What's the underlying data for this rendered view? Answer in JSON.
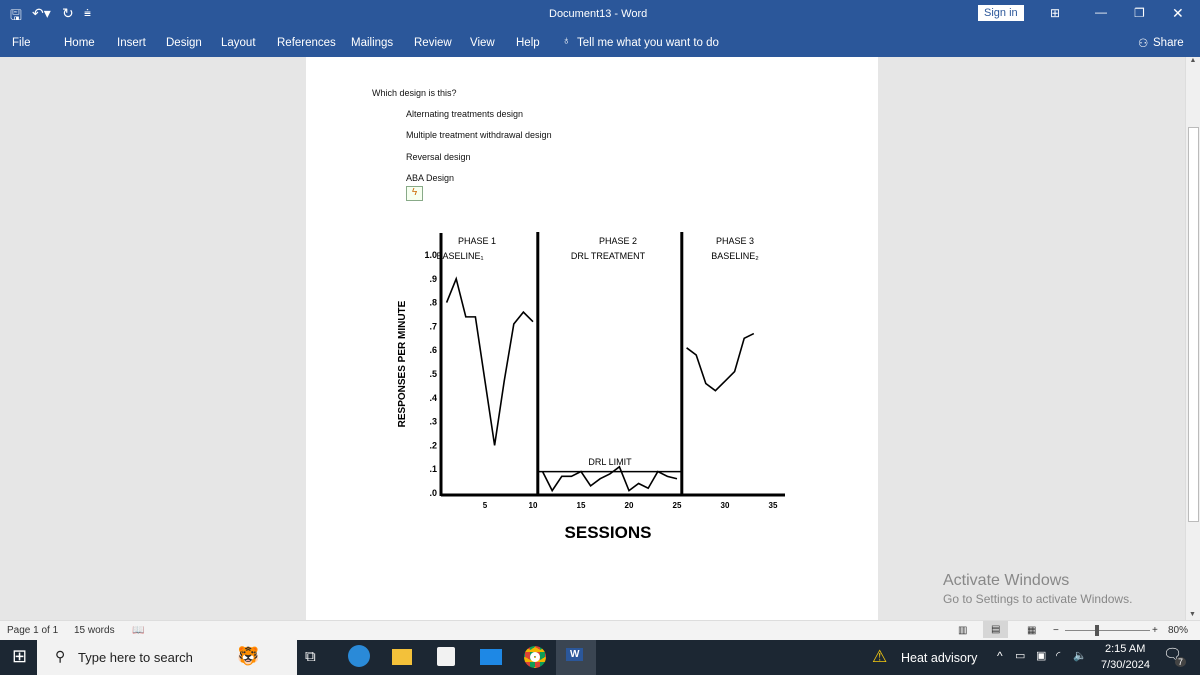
{
  "window": {
    "title": "Document13  -  Word",
    "sign_in": "Sign in"
  },
  "ribbon": {
    "tabs": [
      "File",
      "Home",
      "Insert",
      "Design",
      "Layout",
      "References",
      "Mailings",
      "Review",
      "View",
      "Help"
    ],
    "tell_me": "Tell me what you want to do",
    "share": "Share"
  },
  "document": {
    "question": "Which design is this?",
    "options": [
      "Alternating treatments design",
      "Multiple treatment withdrawal design",
      "Reversal design",
      "ABA Design"
    ]
  },
  "chart_data": {
    "type": "line",
    "xlabel": "SESSIONS",
    "ylabel": "RESPONSES  PER  MINUTE",
    "xlim": [
      0,
      35
    ],
    "ylim": [
      0,
      1.0
    ],
    "x_ticks": [
      "5",
      "10",
      "15",
      "20",
      "25",
      "30",
      "35"
    ],
    "y_ticks": [
      ".0",
      ".1",
      ".2",
      ".3",
      ".4",
      ".5",
      ".6",
      ".7",
      ".8",
      ".9",
      "1.0"
    ],
    "phases": [
      {
        "title": "PHASE  1",
        "subtitle": "BASELINE₁",
        "sessions": [
          1,
          2,
          3,
          4,
          5,
          6,
          7,
          8,
          9,
          10
        ],
        "values": [
          0.8,
          0.9,
          0.74,
          0.74,
          0.47,
          0.2,
          0.47,
          0.71,
          0.76,
          0.72
        ]
      },
      {
        "title": "PHASE  2",
        "subtitle": "DRL   TREATMENT",
        "sessions": [
          11,
          12,
          13,
          14,
          15,
          16,
          17,
          18,
          19,
          20,
          21,
          22,
          23,
          24,
          25
        ],
        "values": [
          0.09,
          0.01,
          0.07,
          0.07,
          0.09,
          0.03,
          0.06,
          0.08,
          0.11,
          0.01,
          0.04,
          0.02,
          0.09,
          0.07,
          0.06
        ]
      },
      {
        "title": "PHASE  3",
        "subtitle": "BASELINE₂",
        "sessions": [
          26,
          27,
          28,
          29,
          30,
          31,
          32,
          33
        ],
        "values": [
          0.61,
          0.58,
          0.46,
          0.43,
          0.47,
          0.51,
          0.65,
          0.67
        ]
      }
    ],
    "phase_boundaries": [
      10.5,
      25.5
    ],
    "drl_limit": {
      "label": "DRL   LIMIT",
      "value": 0.09
    }
  },
  "status": {
    "page": "Page 1 of 1",
    "words": "15 words",
    "zoom": "80%"
  },
  "watermark": {
    "title": "Activate Windows",
    "subtitle": "Go to Settings to activate Windows."
  },
  "taskbar": {
    "search_placeholder": "Type here to search",
    "weather": "Heat advisory",
    "time": "2:15 AM",
    "date": "7/30/2024",
    "notifications": "7"
  }
}
